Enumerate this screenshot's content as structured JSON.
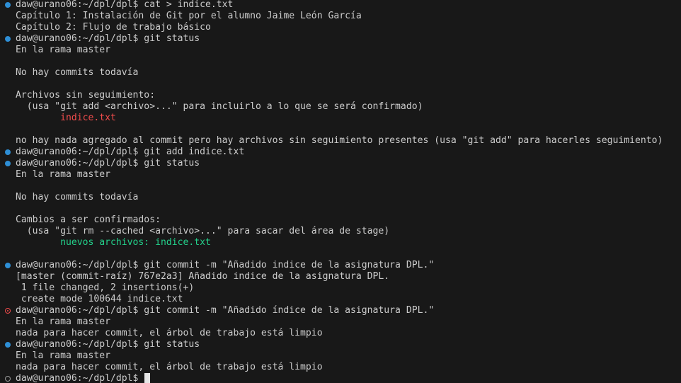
{
  "terminal": {
    "lines": [
      {
        "text": "daw@urano06:~/dpl/dpl$ cat > indice.txt",
        "mark": "ok"
      },
      {
        "text": "Capítulo 1: Instalación de Git por el alumno Jaime León García"
      },
      {
        "text": "Capítulo 2: Flujo de trabajo básico"
      },
      {
        "text": "daw@urano06:~/dpl/dpl$ git status",
        "mark": "ok"
      },
      {
        "text": "En la rama master"
      },
      {
        "text": ""
      },
      {
        "text": "No hay commits todavía"
      },
      {
        "text": ""
      },
      {
        "text": "Archivos sin seguimiento:"
      },
      {
        "text": "  (usa \"git add <archivo>...\" para incluirlo a lo que se será confirmado)"
      },
      {
        "text": "\tindice.txt",
        "color": "red"
      },
      {
        "text": ""
      },
      {
        "text": "no hay nada agregado al commit pero hay archivos sin seguimiento presentes (usa \"git add\" para hacerles seguimiento)"
      },
      {
        "text": "daw@urano06:~/dpl/dpl$ git add indice.txt",
        "mark": "ok"
      },
      {
        "text": "daw@urano06:~/dpl/dpl$ git status",
        "mark": "ok"
      },
      {
        "text": "En la rama master"
      },
      {
        "text": ""
      },
      {
        "text": "No hay commits todavía"
      },
      {
        "text": ""
      },
      {
        "text": "Cambios a ser confirmados:"
      },
      {
        "text": "  (usa \"git rm --cached <archivo>...\" para sacar del área de stage)"
      },
      {
        "text": "\tnuevos archivos: indice.txt",
        "color": "green"
      },
      {
        "text": ""
      },
      {
        "text": "daw@urano06:~/dpl/dpl$ git commit -m \"Añadido indice de la asignatura DPL.\"",
        "mark": "ok"
      },
      {
        "text": "[master (commit-raíz) 767e2a3] Añadido indice de la asignatura DPL."
      },
      {
        "text": " 1 file changed, 2 insertions(+)"
      },
      {
        "text": " create mode 100644 indice.txt"
      },
      {
        "text": "daw@urano06:~/dpl/dpl$ git commit -m \"Añadido índice de la asignatura DPL.\"",
        "mark": "err"
      },
      {
        "text": "En la rama master"
      },
      {
        "text": "nada para hacer commit, el árbol de trabajo está limpio"
      },
      {
        "text": "daw@urano06:~/dpl/dpl$ git status",
        "mark": "ok"
      },
      {
        "text": "En la rama master"
      },
      {
        "text": "nada para hacer commit, el árbol de trabajo está limpio"
      },
      {
        "text": "daw@urano06:~/dpl/dpl$ ",
        "mark": "pending",
        "cursor": true
      }
    ]
  },
  "colors": {
    "background": "#181818",
    "foreground": "#cccccc",
    "success_mark": "#2e8fd6",
    "error": "#f14c4c",
    "staged": "#23d18b"
  }
}
